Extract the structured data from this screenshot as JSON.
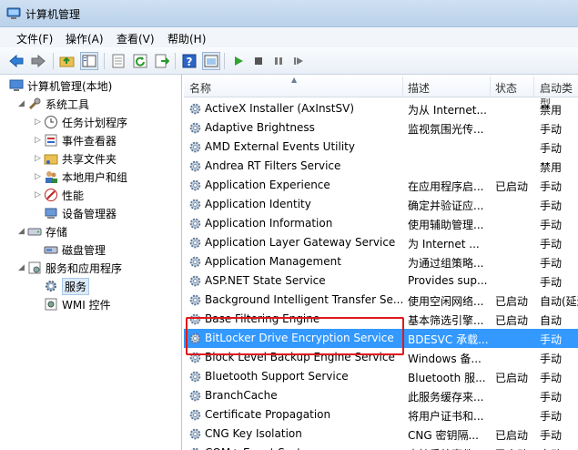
{
  "window": {
    "title": "计算机管理"
  },
  "menu": [
    "文件(F)",
    "操作(A)",
    "查看(V)",
    "帮助(H)"
  ],
  "toolbar_icons": [
    "back-icon",
    "forward-icon",
    "up-folder-icon",
    "show-tree-icon",
    "properties-icon",
    "refresh-icon",
    "export-icon",
    "help-icon",
    "view-icon",
    "start-service-icon",
    "stop-service-icon",
    "pause-service-icon",
    "restart-service-icon"
  ],
  "tree": [
    {
      "label": "计算机管理(本地)",
      "icon": "computer-icon"
    },
    {
      "label": "系统工具",
      "icon": "tools-icon"
    },
    {
      "label": "任务计划程序",
      "icon": "clock-icon"
    },
    {
      "label": "事件查看器",
      "icon": "event-viewer-icon"
    },
    {
      "label": "共享文件夹",
      "icon": "shared-folder-icon"
    },
    {
      "label": "本地用户和组",
      "icon": "users-icon"
    },
    {
      "label": "性能",
      "icon": "performance-icon"
    },
    {
      "label": "设备管理器",
      "icon": "device-manager-icon"
    },
    {
      "label": "存储",
      "icon": "storage-icon"
    },
    {
      "label": "磁盘管理",
      "icon": "disk-icon"
    },
    {
      "label": "服务和应用程序",
      "icon": "services-apps-icon"
    },
    {
      "label": "服务",
      "icon": "services-gear-icon"
    },
    {
      "label": "WMI 控件",
      "icon": "wmi-icon"
    }
  ],
  "columns": {
    "name": "名称",
    "desc": "描述",
    "status": "状态",
    "startup": "启动类型"
  },
  "services": [
    {
      "name": "ActiveX Installer (AxInstSV)",
      "desc": "为从 Internet...",
      "status": "",
      "startup": "禁用"
    },
    {
      "name": "Adaptive Brightness",
      "desc": "监视氛围光传...",
      "status": "",
      "startup": "手动"
    },
    {
      "name": "AMD External Events Utility",
      "desc": "",
      "status": "",
      "startup": "手动"
    },
    {
      "name": "Andrea RT Filters Service",
      "desc": "",
      "status": "",
      "startup": "禁用"
    },
    {
      "name": "Application Experience",
      "desc": "在应用程序启...",
      "status": "已启动",
      "startup": "手动"
    },
    {
      "name": "Application Identity",
      "desc": "确定并验证应...",
      "status": "",
      "startup": "手动"
    },
    {
      "name": "Application Information",
      "desc": "使用辅助管理...",
      "status": "",
      "startup": "手动"
    },
    {
      "name": "Application Layer Gateway Service",
      "desc": "为 Internet ...",
      "status": "",
      "startup": "手动"
    },
    {
      "name": "Application Management",
      "desc": "为通过组策略...",
      "status": "",
      "startup": "手动"
    },
    {
      "name": "ASP.NET State Service",
      "desc": "Provides sup...",
      "status": "",
      "startup": "手动"
    },
    {
      "name": "Background Intelligent Transfer Se...",
      "desc": "使用空闲网络...",
      "status": "已启动",
      "startup": "自动(延迟"
    },
    {
      "name": "Base Filtering Engine",
      "desc": "基本筛选引擎...",
      "status": "已启动",
      "startup": "自动"
    },
    {
      "name": "BitLocker Drive Encryption Service",
      "desc": "BDESVC 承载...",
      "status": "",
      "startup": "手动",
      "selected": true
    },
    {
      "name": "Block Level Backup Engine Service",
      "desc": "Windows 备...",
      "status": "",
      "startup": "手动"
    },
    {
      "name": "Bluetooth Support Service",
      "desc": "Bluetooth 服...",
      "status": "已启动",
      "startup": "手动"
    },
    {
      "name": "BranchCache",
      "desc": "此服务缓存来...",
      "status": "",
      "startup": "手动"
    },
    {
      "name": "Certificate Propagation",
      "desc": "将用户证书和...",
      "status": "",
      "startup": "手动"
    },
    {
      "name": "CNG Key Isolation",
      "desc": "CNG 密钥隔...",
      "status": "已启动",
      "startup": "手动"
    },
    {
      "name": "COM+ Event System",
      "desc": "支持系统事件...",
      "status": "已启动",
      "startup": "自动"
    }
  ]
}
